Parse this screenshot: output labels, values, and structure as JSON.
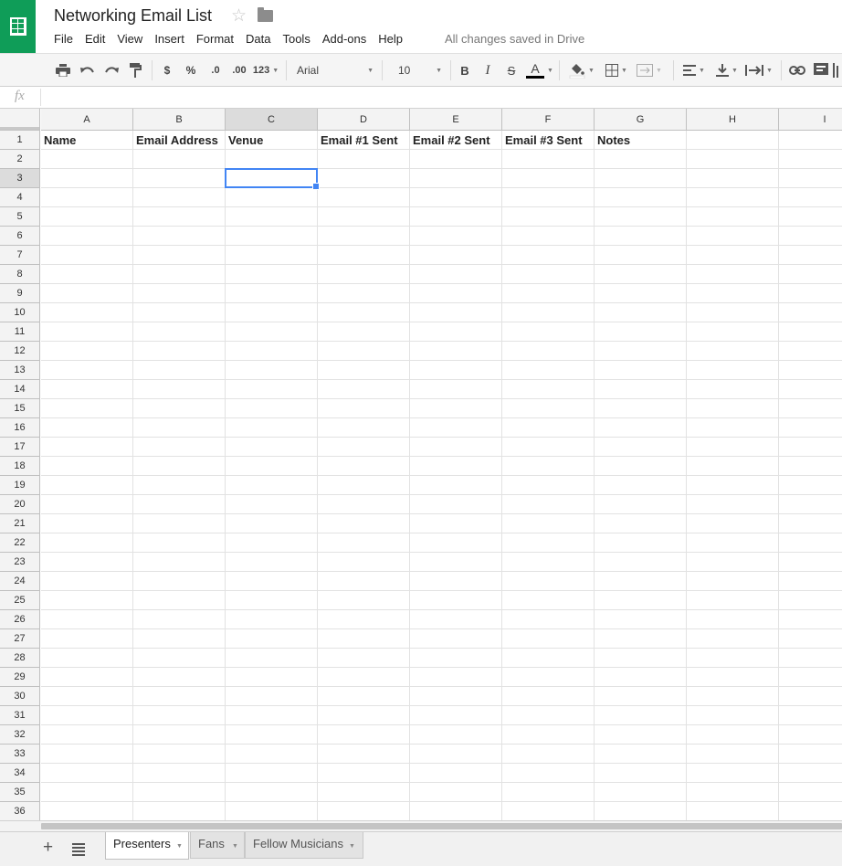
{
  "app": {
    "doc_title": "Networking Email List",
    "save_status": "All changes saved in Drive",
    "logo_icon": "google-sheets-logo-icon",
    "brand_color": "#0f9d58"
  },
  "menu": [
    "File",
    "Edit",
    "View",
    "Insert",
    "Format",
    "Data",
    "Tools",
    "Add-ons",
    "Help"
  ],
  "toolbar": {
    "currency": "$",
    "percent": "%",
    "decrease_decimal": ".0",
    "increase_decimal": ".00",
    "more_formats": "123",
    "font": "Arial",
    "font_size": "10",
    "bold": "B",
    "italic": "I",
    "strikethrough": "S",
    "text_color": "A"
  },
  "formula_bar": {
    "fx_label": "fx",
    "value": ""
  },
  "sheet": {
    "columns": [
      "A",
      "B",
      "C",
      "D",
      "E",
      "F",
      "G",
      "H",
      "I"
    ],
    "row_count": 36,
    "selected_cell": "C3",
    "header_row": [
      "Name",
      "Email Address",
      "Venue",
      "Email #1 Sent",
      "Email #2 Sent",
      "Email #3 Sent",
      "Notes",
      "",
      ""
    ]
  },
  "tabs": [
    {
      "label": "Presenters",
      "active": true
    },
    {
      "label": "Fans",
      "active": false
    },
    {
      "label": "Fellow Musicians",
      "active": false
    }
  ],
  "colors": {
    "selection": "#4285f4",
    "header_bg": "#f3f3f3",
    "active_header_bg": "#dcdcdc"
  }
}
